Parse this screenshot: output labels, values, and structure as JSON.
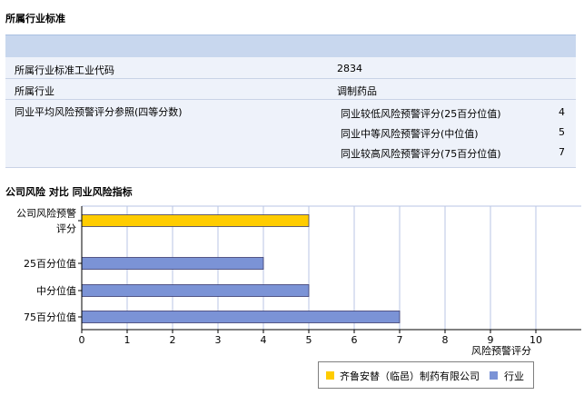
{
  "section1_title": "所属行业标准",
  "info": {
    "row1_label": "所属行业标准工业代码",
    "row1_value": "2834",
    "row2_label": "所属行业",
    "row2_value": "调制药品",
    "row3_label": "同业平均风险预警评分参照(四等分数)",
    "sub": [
      {
        "label": "同业较低风险预警评分(25百分位值)",
        "value": "4"
      },
      {
        "label": "同业中等风险预警评分(中位值)",
        "value": "5"
      },
      {
        "label": "同业较高风险预警评分(75百分位值)",
        "value": "7"
      }
    ]
  },
  "section2_title": "公司风险 对比 同业风险指标",
  "colors": {
    "company": "#ffcc00",
    "industry": "#7b93d6",
    "grid": "#b9c6e4"
  },
  "chart_data": {
    "type": "bar",
    "orientation": "horizontal",
    "categories": [
      "公司风险预警评分",
      "25百分位值",
      "中分位值",
      "75百分位值"
    ],
    "category_labels": [
      [
        "公司风险预警",
        "评分"
      ],
      [
        "25百分位值"
      ],
      [
        "中分位值"
      ],
      [
        "75百分位值"
      ]
    ],
    "series": [
      {
        "name": "齐鲁安替（临邑）制药有限公司",
        "color": "#ffcc00",
        "values": [
          5,
          null,
          null,
          null
        ]
      },
      {
        "name": "行业",
        "color": "#7b93d6",
        "values": [
          null,
          4,
          5,
          7
        ]
      }
    ],
    "xlabel": "风险预警评分",
    "xlim": [
      0,
      11
    ],
    "xticks": [
      0,
      1,
      2,
      3,
      4,
      5,
      6,
      7,
      8,
      9,
      10
    ],
    "grid": true,
    "legend": "bottom"
  }
}
